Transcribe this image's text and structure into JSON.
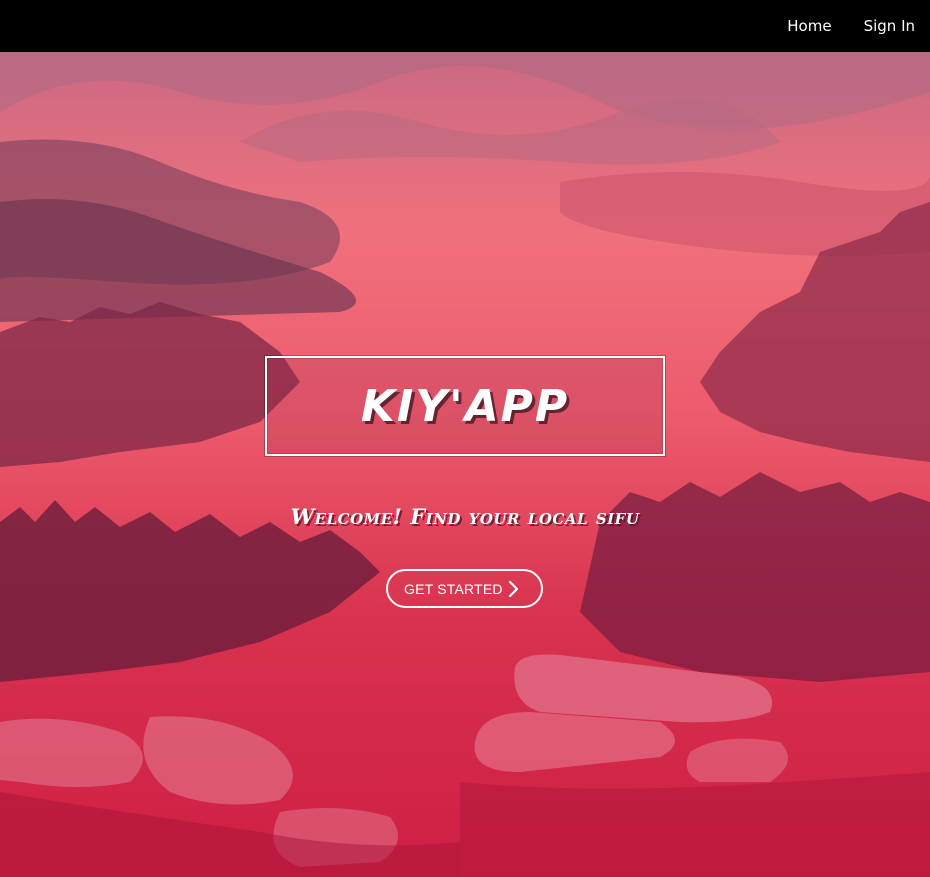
{
  "nav": {
    "links": [
      {
        "label": "Home"
      },
      {
        "label": "Sign In"
      }
    ]
  },
  "hero": {
    "title": "KIY'APP",
    "tagline": "Welcome! Find your local sifu",
    "cta_label": "GET STARTED",
    "cta_icon": "chevron-right-icon"
  },
  "colors": {
    "navbar_bg": "#000000",
    "hero_top": "#c96a84",
    "hero_mid": "#f0707c",
    "hero_bottom": "#cf1e44",
    "text": "#ffffff"
  }
}
